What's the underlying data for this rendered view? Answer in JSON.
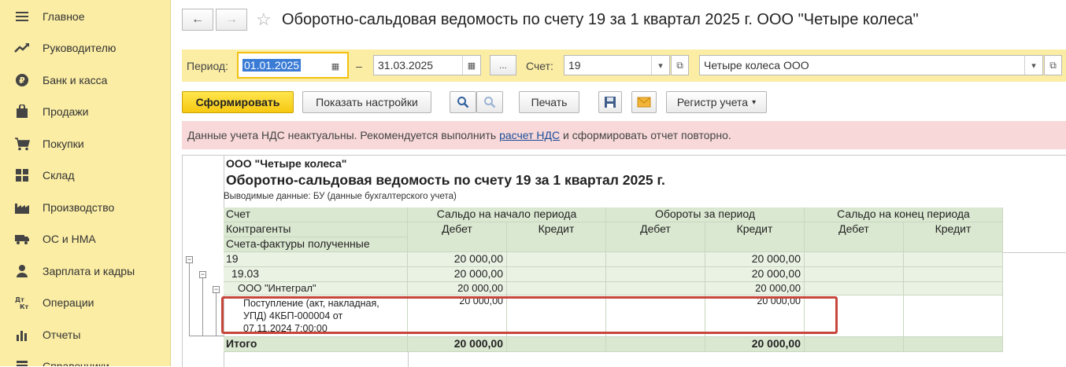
{
  "sidebar": {
    "items": [
      {
        "label": "Главное",
        "icon": "menu-icon"
      },
      {
        "label": "Руководителю",
        "icon": "trend-icon"
      },
      {
        "label": "Банк и касса",
        "icon": "coin-icon"
      },
      {
        "label": "Продажи",
        "icon": "bag-icon"
      },
      {
        "label": "Покупки",
        "icon": "cart-icon"
      },
      {
        "label": "Склад",
        "icon": "warehouse-icon"
      },
      {
        "label": "Производство",
        "icon": "factory-icon"
      },
      {
        "label": "ОС и НМА",
        "icon": "truck-icon"
      },
      {
        "label": "Зарплата и кадры",
        "icon": "person-icon"
      },
      {
        "label": "Операции",
        "icon": "dt-kt-icon"
      },
      {
        "label": "Отчеты",
        "icon": "chart-icon"
      },
      {
        "label": "Справочники",
        "icon": "book-icon"
      }
    ]
  },
  "header": {
    "title": "Оборотно-сальдовая ведомость по счету 19 за 1 квартал 2025 г. ООО \"Четыре колеса\""
  },
  "params": {
    "period_label": "Период:",
    "date_from": "01.01.2025",
    "dash": "–",
    "date_to": "31.03.2025",
    "ellipsis": "...",
    "account_label": "Счет:",
    "account": "19",
    "organization": "Четыре колеса ООО"
  },
  "toolbar": {
    "generate": "Сформировать",
    "show_settings": "Показать настройки",
    "print": "Печать",
    "register": "Регистр учета"
  },
  "warning": {
    "before": "Данные учета НДС неактуальны. Рекомендуется выполнить ",
    "link": "расчет НДС",
    "after": " и сформировать отчет повторно."
  },
  "report": {
    "org": "ООО \"Четыре колеса\"",
    "title": "Оборотно-сальдовая ведомость по счету 19 за 1 квартал 2025 г.",
    "subtitle": "Выводимые данные: БУ (данные бухгалтерского учета)",
    "col_headers": {
      "account": "Счет",
      "counterparties": "Контрагенты",
      "invoices": "Счета-фактуры полученные",
      "opening": "Сальдо на начало периода",
      "turnover": "Обороты за период",
      "closing": "Сальдо на конец периода",
      "debit": "Дебет",
      "credit": "Кредит"
    },
    "rows": [
      {
        "name": "19",
        "open_debit": "20 000,00",
        "turn_credit": "20 000,00"
      },
      {
        "name": "19.03",
        "open_debit": "20 000,00",
        "turn_credit": "20 000,00"
      },
      {
        "name": "ООО \"Интеграл\"",
        "open_debit": "20 000,00",
        "turn_credit": "20 000,00"
      },
      {
        "name_lines": [
          "Поступление (акт, накладная,",
          "УПД) 4КБП-000004 от",
          "07.11.2024 7:00:00"
        ],
        "open_debit": "20 000,00",
        "turn_credit": "20 000,00"
      }
    ],
    "total": {
      "name": "Итого",
      "open_debit": "20 000,00",
      "turn_credit": "20 000,00"
    }
  },
  "colors": {
    "sidebar_bg": "#fbeda4",
    "accent_button": "#f6c812",
    "warning_bg": "#f8d8d8",
    "table_header": "#dbe8d1",
    "table_row": "#eaf2e4",
    "highlight": "#c8473c"
  }
}
